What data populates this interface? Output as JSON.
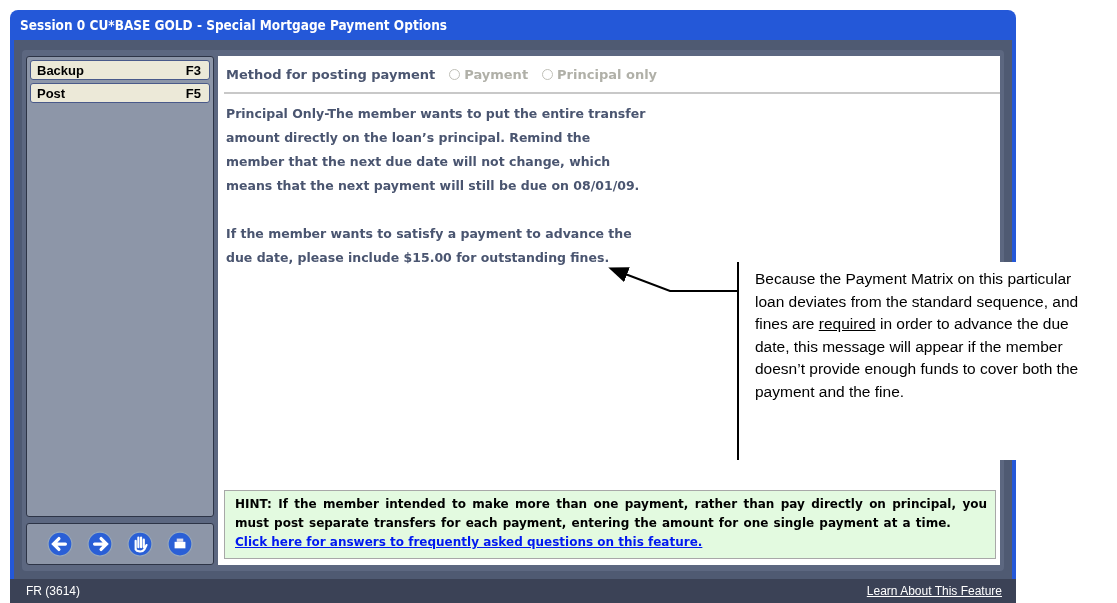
{
  "window": {
    "title": "Session 0 CU*BASE GOLD - Special Mortgage Payment Options"
  },
  "sidebar": {
    "buttons": [
      {
        "label": "Backup",
        "key": "F3"
      },
      {
        "label": "Post",
        "key": "F5"
      }
    ]
  },
  "method": {
    "label": "Method for posting payment",
    "options": [
      {
        "label": "Payment",
        "selected": false,
        "disabled": true
      },
      {
        "label": "Principal only",
        "selected": false,
        "disabled": true
      }
    ]
  },
  "message": {
    "paragraphs": [
      "Principal Only-The member wants to put the entire transfer amount directly on the loan’s principal.  Remind the member that the next due date will not change, which means that the next payment will still be due on 08/01/09.",
      "If the member wants to satisfy a payment to advance the due date, please include $15.00 for outstanding fines."
    ]
  },
  "hint": {
    "text": "HINT:  If the member intended to make more than one payment, rather than pay directly on principal, you must post separate transfers for each payment, entering the amount for one single payment at a time.",
    "link": "Click here for answers to frequently asked questions on this feature."
  },
  "status_bar": {
    "left": "FR (3614)",
    "link": "Learn About This Feature"
  },
  "callout": {
    "segments": [
      {
        "text": "Because the Payment Matrix on this particular loan deviates from the standard sequence, and fines are ",
        "underline": false
      },
      {
        "text": "required",
        "underline": true
      },
      {
        "text": " in order to advance the due date, this message will appear if the member doesn’t provide enough funds to cover both the payment and the fine.",
        "underline": false
      }
    ]
  }
}
